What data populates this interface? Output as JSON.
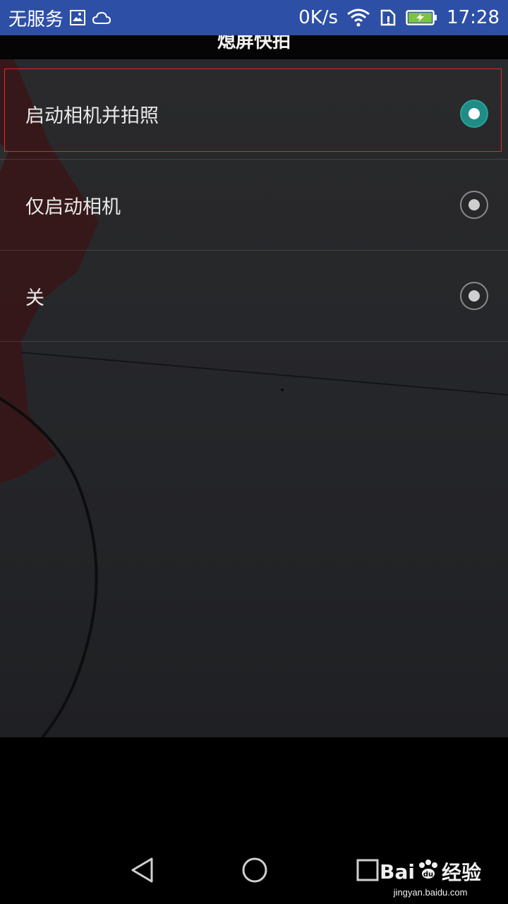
{
  "status_bar": {
    "carrier": "无服务",
    "speed": "0K/s",
    "time": "17:28",
    "icons": [
      "image-notification-icon",
      "cloud-icon",
      "wifi-icon",
      "sim-card-icon",
      "battery-charging-icon"
    ],
    "background": "#2d4fa6"
  },
  "header": {
    "title": "熄屏快拍"
  },
  "options": [
    {
      "label": "启动相机并拍照",
      "selected": true
    },
    {
      "label": "仅启动相机",
      "selected": false
    },
    {
      "label": "关",
      "selected": false
    }
  ],
  "colors": {
    "accent": "#1f8c86",
    "highlight_border": "#e0262a"
  },
  "nav": {
    "icons": [
      "back-icon",
      "home-icon",
      "recents-icon"
    ]
  },
  "watermark": {
    "brand": "Bai",
    "brand2": "经验",
    "url": "jingyan.baidu.com"
  }
}
